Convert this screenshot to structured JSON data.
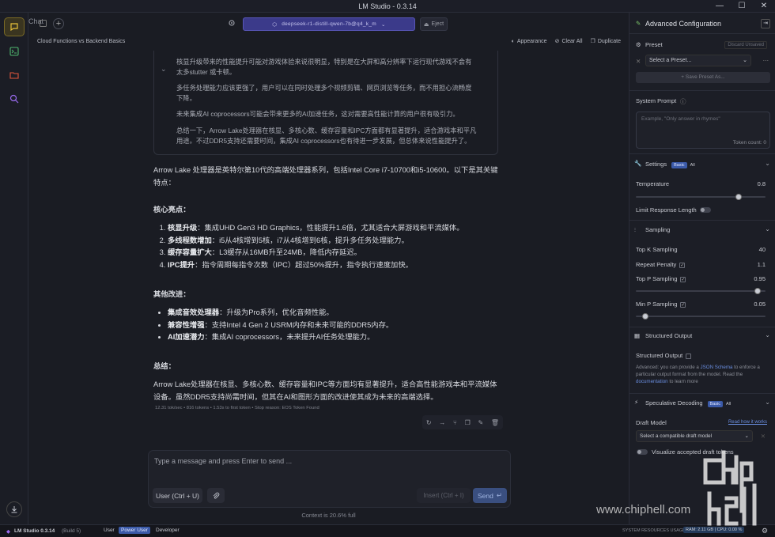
{
  "window": {
    "title": "LM Studio - 0.3.14",
    "controls": [
      "—",
      "☐",
      "✕"
    ]
  },
  "top": {
    "chat_tab": "Chat",
    "model": "deepseek-r1-distill-qwen-7b@q4_k_m",
    "eject": "Eject"
  },
  "subbar": {
    "title": "Cloud Functions vs Backend Basics",
    "appearance": "Appearance",
    "clear_all": "Clear All",
    "duplicate": "Duplicate"
  },
  "thinking": [
    "核显升级带来的性能提升可能对游戏体验来说很明显，特别是在大屏和高分辨率下运行现代游戏不会有太多stutter 或卡顿。",
    "多任务处理能力应该更强了，用户可以在同时处理多个视频剪辑、网页浏览等任务，而不用担心流畅度下降。",
    "未来集成AI coprocessors可能会带来更多的AI加速任务，这对需要高性能计算的用户很有吸引力。",
    "总结一下，Arrow Lake处理器在核显、多核心数、缓存容量和IPC方面都有显著提升，适合游戏本和平凡用途。不过DDR5支持还需要时间，集成AI coprocessors也有待进一步发展，但总体来说性能提升了。"
  ],
  "response": {
    "intro": "Arrow Lake 处理器是英特尔第10代的高端处理器系列，包括Intel Core i7-10700和i5-10600。以下是其关键特点：",
    "h1": "核心亮点：",
    "core": [
      {
        "b": "核显升级",
        "t": "：集成UHD Gen3 HD Graphics，性能提升1.6倍，尤其适合大屏游戏和平流媒体。"
      },
      {
        "b": "多线程数增加",
        "t": "：i5从4核增到5核，i7从4核增到6核，提升多任务处理能力。"
      },
      {
        "b": "缓存容量扩大",
        "t": "：L3缓存从16MB升至24MB，降低内存延迟。"
      },
      {
        "b": "IPC提升",
        "t": "：指令周期每指令次数（IPC）超过50%提升，指令执行速度加快。"
      }
    ],
    "h2": "其他改进：",
    "other": [
      {
        "b": "集成音效处理器",
        "t": "：升级为Pro系列，优化音频性能。"
      },
      {
        "b": "兼容性增强",
        "t": "：支持Intel 4 Gen 2 USRM内存和未来可能的DDR5内存。"
      },
      {
        "b": "AI加速潜力",
        "t": "：集成AI coprocessors，未来提升AI任务处理能力。"
      }
    ],
    "h3": "总结：",
    "summary": "Arrow Lake处理器在核显、多核心数、缓存容量和IPC等方面均有显著提升，适合高性能游戏本和平流媒体设备。虽然DDR5支持尚需时间，但其在AI和图形方面的改进使其成为未来的高端选择。",
    "stats": "12.31 tok/sec • 816 tokens • 1.53s to first token • Stop reason: EOS Token Found"
  },
  "composer": {
    "placeholder": "Type a message and press Enter to send ...",
    "role": "User (Ctrl + U)",
    "insert": "Insert (Ctrl + I)",
    "send": "Send"
  },
  "context": "Context is 20.6% full",
  "right": {
    "title": "Advanced Configuration",
    "preset": "Preset",
    "discard": "Discard Unsaved",
    "select_preset": "Select a Preset...",
    "save_preset": "Save Preset As...",
    "system_prompt": "System Prompt",
    "sp_placeholder": "Example, \"Only answer in rhymes\"",
    "token_count": "Token count: 0",
    "settings": "Settings",
    "basic": "Basic",
    "all": "All",
    "temperature": "Temperature",
    "temperature_val": "0.8",
    "limit_len": "Limit Response Length",
    "sampling": "Sampling",
    "topk": "Top K Sampling",
    "topk_val": "40",
    "repeat": "Repeat Penalty",
    "repeat_val": "1.1",
    "topp": "Top P Sampling",
    "topp_val": "0.95",
    "minp": "Min P Sampling",
    "minp_val": "0.05",
    "structured": "Structured Output",
    "structured_label": "Structured Output",
    "adv_1": "Advanced: you can provide a ",
    "adv_link": "JSON Schema",
    "adv_2": " to enforce a particular output format from the model. Read the ",
    "adv_doc": "documentation",
    "adv_3": " to learn more",
    "spec": "Speculative Decoding",
    "draft": "Draft Model",
    "read_how": "Read how it works",
    "select_draft": "Select a compatible draft model",
    "visualize": "Visualize accepted draft tokens"
  },
  "status": {
    "app": "LM Studio 0.3.14",
    "build": "(Build 5)",
    "user": "User",
    "power": "Power User",
    "dev": "Developer",
    "resources": "SYSTEM RESOURCES USAGE:",
    "ram": "RAM: 2.11 GB",
    "cpu": "CPU: 0.00 %"
  },
  "watermark": {
    "text": "www.chiphell.com"
  }
}
